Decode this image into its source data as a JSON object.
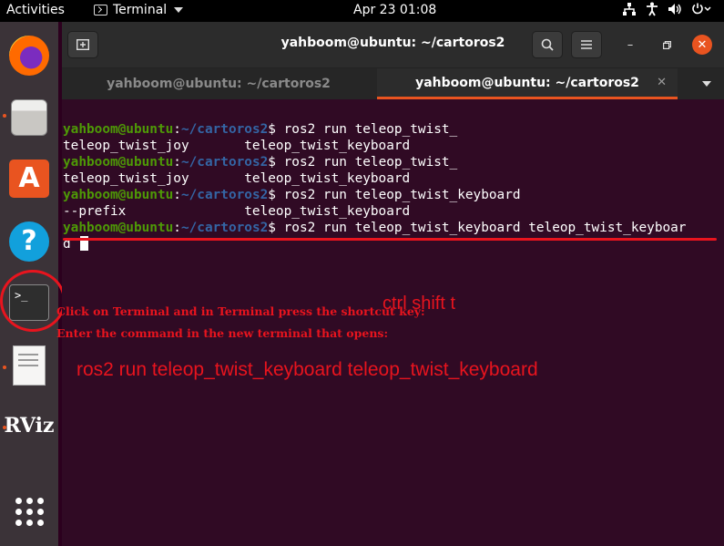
{
  "topbar": {
    "activities": "Activities",
    "app_menu": "Terminal",
    "clock": "Apr 23  01:08",
    "tray_icons": [
      "network-icon",
      "accessibility-icon",
      "volume-icon",
      "power-icon"
    ]
  },
  "dock": {
    "items": [
      "firefox-icon",
      "files-icon",
      "software-store-icon",
      "help-icon",
      "terminal-icon",
      "text-editor-icon",
      "rviz-icon",
      "show-apps-icon"
    ],
    "rviz_label": "RViz",
    "terminal_glyph": ">_"
  },
  "window": {
    "title": "yahboom@ubuntu: ~/cartoros2",
    "tabs": [
      {
        "label": "yahboom@ubuntu: ~/cartoros2",
        "active": false
      },
      {
        "label": "yahboom@ubuntu: ~/cartoros2",
        "active": true
      }
    ]
  },
  "terminal": {
    "user": "yahboom@ubuntu",
    "path": "~/cartoros2",
    "lines": [
      {
        "type": "prompt",
        "cmd": " ros2 run teleop_twist_"
      },
      {
        "type": "out",
        "text": "teleop_twist_joy       teleop_twist_keyboard"
      },
      {
        "type": "prompt",
        "cmd": " ros2 run teleop_twist_"
      },
      {
        "type": "out",
        "text": "teleop_twist_joy       teleop_twist_keyboard"
      },
      {
        "type": "prompt",
        "cmd": " ros2 run teleop_twist_keyboard"
      },
      {
        "type": "out",
        "text": "--prefix               teleop_twist_keyboard"
      },
      {
        "type": "prompt",
        "cmd": " ros2 run teleop_twist_keyboard teleop_twist_keyboar"
      },
      {
        "type": "out",
        "text": "d",
        "cursor": true
      }
    ]
  },
  "annotations": {
    "line1": "Click on Terminal and in Terminal press the shortcut key:",
    "shortcut": "ctrl shift t",
    "line2": "Enter the command in the new terminal that opens:",
    "command": "ros2 run teleop_twist_keyboard teleop_twist_keyboard",
    "color": "#e8141e"
  },
  "colors": {
    "terminal_bg": "#300a24",
    "prompt_user": "#4e9a06",
    "prompt_path": "#3465a4",
    "accent": "#e95420"
  }
}
